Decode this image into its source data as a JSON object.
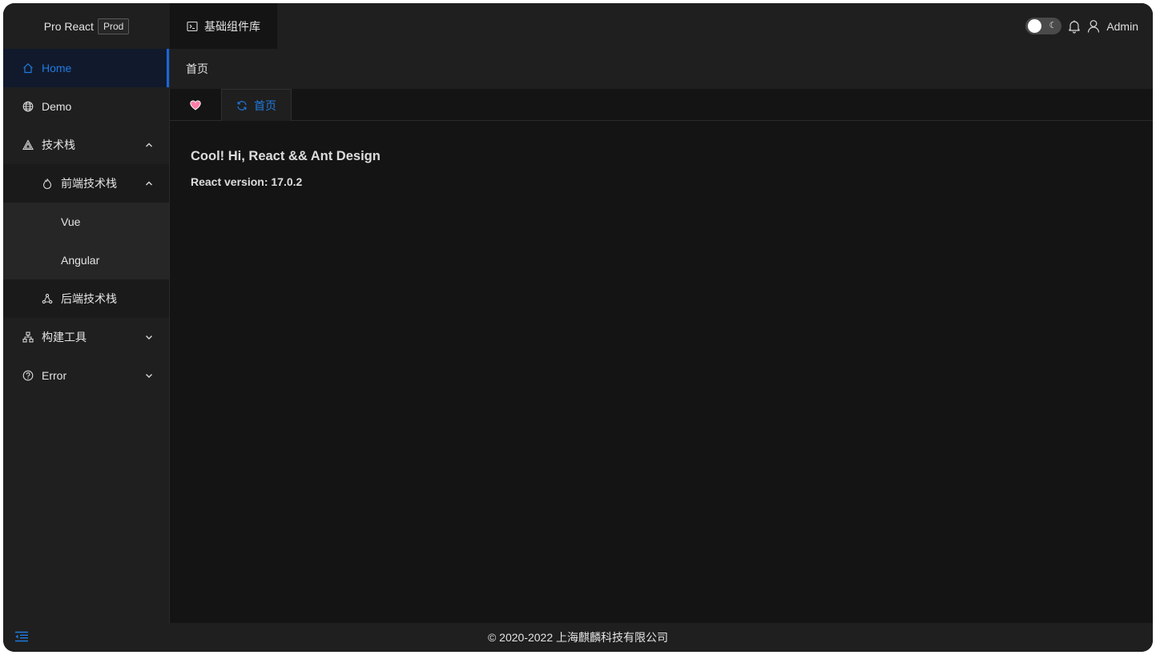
{
  "header": {
    "brand": "Pro React",
    "env_badge": "Prod",
    "top_nav": {
      "label": "基础组件库",
      "icon": "terminal-icon"
    },
    "theme_toggle": {
      "state": "off",
      "icon": "moon-icon"
    },
    "notifications_icon": "bell-icon",
    "user": {
      "name": "Admin",
      "icon": "user-icon"
    }
  },
  "sidebar": {
    "items": [
      {
        "label": "Home",
        "icon": "home-icon",
        "active": true
      },
      {
        "label": "Demo",
        "icon": "globe-icon"
      },
      {
        "label": "技术栈",
        "icon": "triangle-icon",
        "expanded": true,
        "children": [
          {
            "label": "前端技术栈",
            "icon": "fire-icon",
            "expanded": true,
            "children": [
              {
                "label": "Vue"
              },
              {
                "label": "Angular"
              }
            ]
          },
          {
            "label": "后端技术栈",
            "icon": "cluster-icon"
          }
        ]
      },
      {
        "label": "构建工具",
        "icon": "hierarchy-icon",
        "expanded": false
      },
      {
        "label": "Error",
        "icon": "question-circle-icon",
        "expanded": false
      }
    ]
  },
  "breadcrumb": {
    "current": "首页"
  },
  "tabs": [
    {
      "icon": "heart-icon"
    },
    {
      "label": "首页",
      "icon": "reload-icon",
      "active": true
    }
  ],
  "content": {
    "heading": "Cool! Hi, React && Ant Design",
    "version_text": "React version: 17.0.2"
  },
  "footer": {
    "copyright": "© 2020-2022 上海麒麟科技有限公司",
    "collapse_icon": "menu-fold-icon"
  },
  "colors": {
    "accent": "#1f7ae0",
    "background": "#141414",
    "panel": "#1f1f1f",
    "heart": "#ff7ba8"
  }
}
